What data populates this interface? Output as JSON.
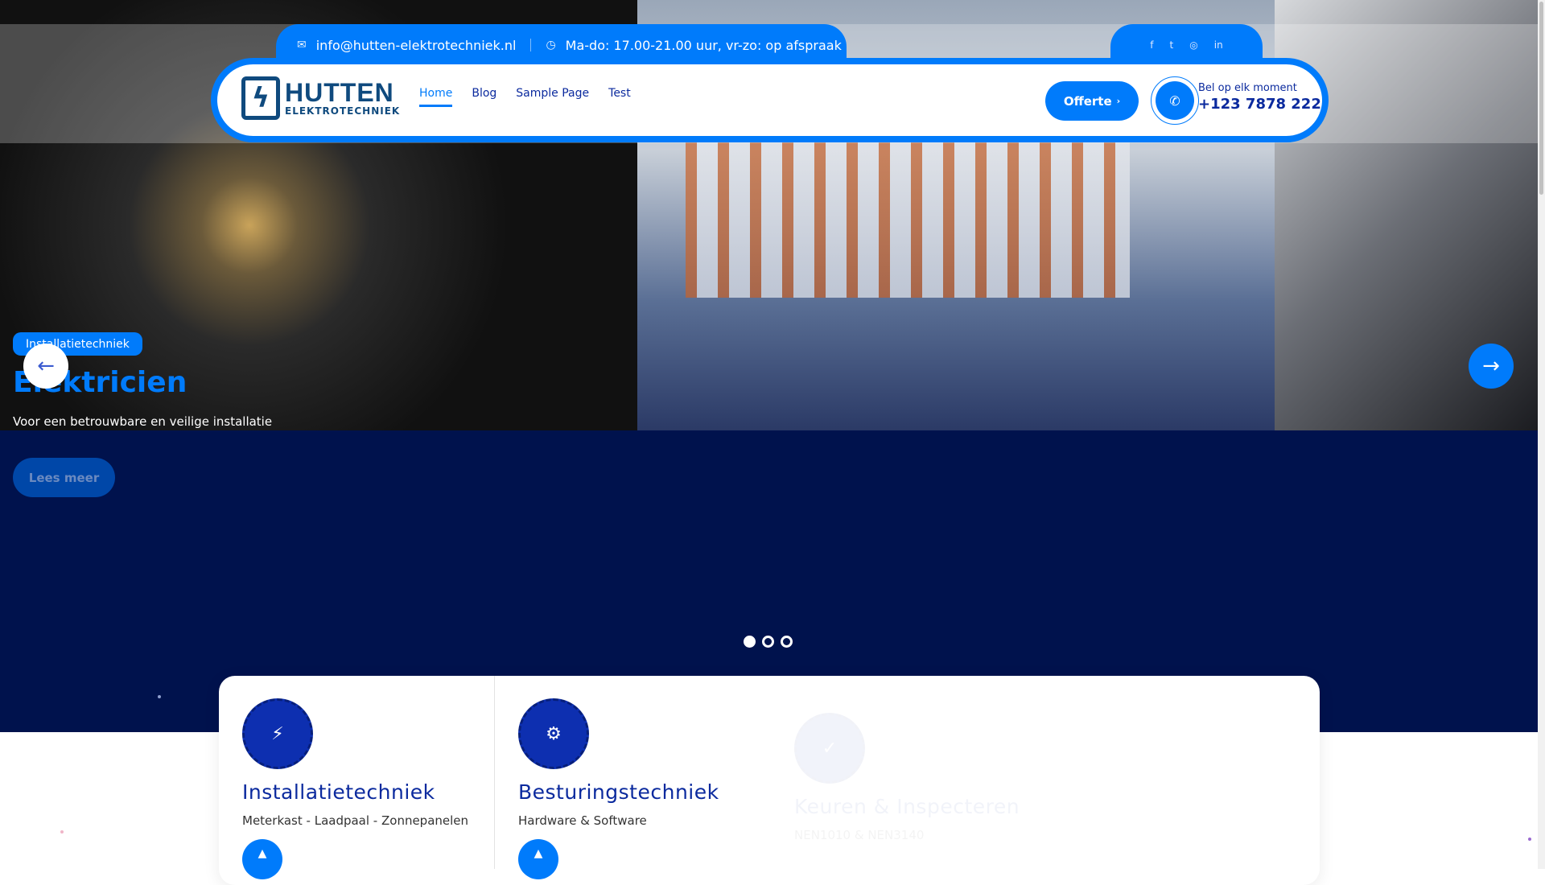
{
  "topbar": {
    "email": "info@hutten-elektrotechniek.nl",
    "hours": "Ma-do: 17.00-21.00 uur, vr-zo: op afspraak",
    "email_icon": "envelope-icon",
    "hours_icon": "clock-icon"
  },
  "social": [
    "facebook-icon",
    "twitter-icon",
    "instagram-icon",
    "linkedin-icon"
  ],
  "logo": {
    "title": "HUTTEN",
    "subtitle": "ELEKTROTECHNIEK"
  },
  "nav": [
    {
      "label": "Home",
      "active": true
    },
    {
      "label": "Blog"
    },
    {
      "label": "Sample Page"
    },
    {
      "label": "Test"
    }
  ],
  "header": {
    "cta_label": "Offerte",
    "phone_label": "Bel op elk moment",
    "phone_number": "+123 7878 222"
  },
  "slider": {
    "badge": "Installatietechniek",
    "title": "Elektricien",
    "subtitle": "Voor een betrouwbare en veilige installatie",
    "button": "Lees meer",
    "active_slide": 1,
    "slide_count": 3
  },
  "services": [
    {
      "title": "Installatietechniek",
      "subtitle": "Meterkast - Laadpaal - Zonnepanelen"
    },
    {
      "title": "Besturingstechniek",
      "subtitle": "Hardware & Software"
    },
    {
      "title": "Keuren & Inspecteren",
      "subtitle": "NEN1010 & NEN3140"
    }
  ],
  "colors": {
    "primary": "#007bfb",
    "navy": "#00124d",
    "text": "#0b2a9e"
  }
}
